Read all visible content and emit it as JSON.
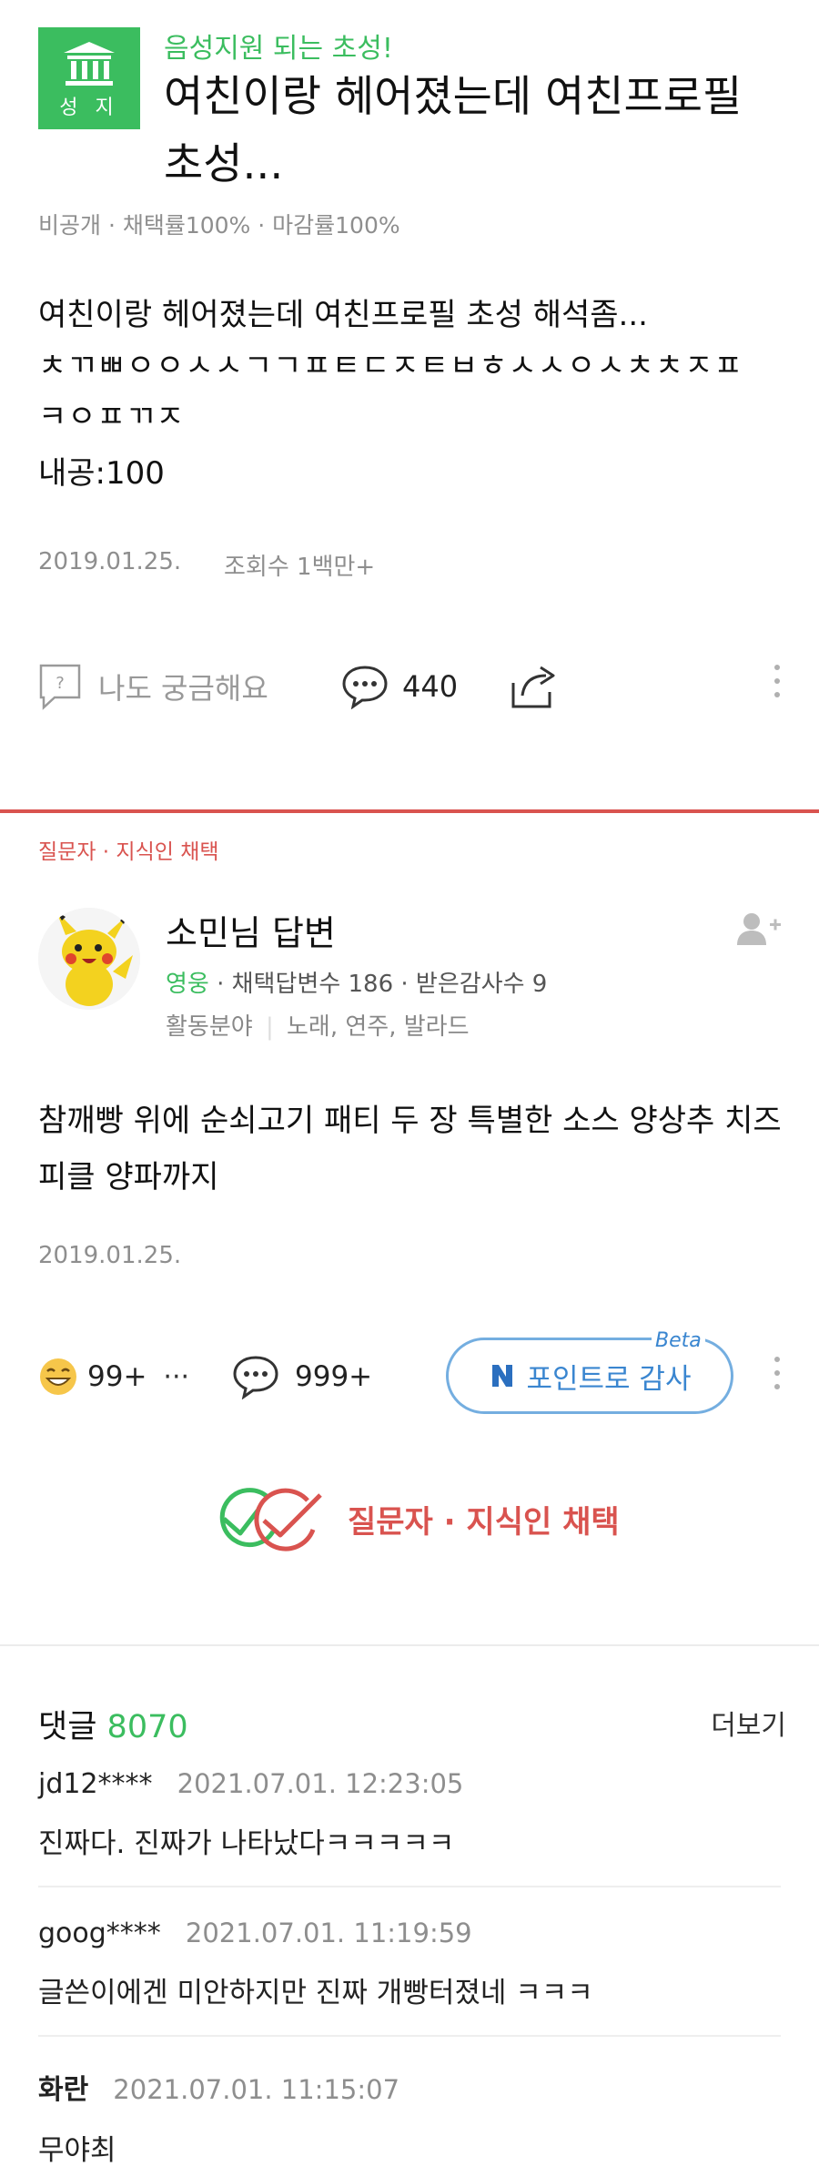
{
  "question": {
    "badge_label": "성 지",
    "tag": "음성지원 되는 초성!",
    "title": "여친이랑 헤어졌는데 여친프로필 초성...",
    "meta": "비공개 · 채택률100% · 마감률100%",
    "body_lines": [
      "여친이랑 헤어졌는데 여친프로필 초성 해석좀...",
      "ㅊㄲㅃㅇㅇㅅㅅㄱㄱㅍㅌㄷㅈㅌㅂㅎㅅㅅㅇㅅㅊㅊㅈㅍ",
      "ㅋㅇㅍㄲㅈ",
      "내공:100"
    ],
    "date": "2019.01.25.",
    "views": "조회수 1백만+",
    "curious_label": "나도 궁금해요",
    "comment_count": "440"
  },
  "answer": {
    "selected_label": "질문자 · 지식인 채택",
    "name": "소민님 답변",
    "grade": "영웅",
    "stats": "· 채택답변수 186 · 받은감사수 9",
    "activity_label": "활동분야",
    "activity_value": "노래, 연주, 발라드",
    "body": "참깨빵 위에 순쇠고기 패티 두 장 특별한 소스 양상추 치즈 피클 양파까지",
    "date": "2019.01.25.",
    "emoji_count": "99+",
    "more_dots": "···",
    "comment_count": "999+",
    "thanks_button": "포인트로 감사",
    "beta": "Beta",
    "select_stamp": "질문자 · 지식인 채택"
  },
  "comments": {
    "label": "댓글",
    "count": "8070",
    "more": "더보기",
    "items": [
      {
        "author": "jd12****",
        "time": "2021.07.01. 12:23:05",
        "text": "진짜다. 진짜가 나타났다ㅋㅋㅋㅋㅋ"
      },
      {
        "author": "goog****",
        "time": "2021.07.01. 11:19:59",
        "text": "글쓴이에겐 미안하지만 진짜 개빵터졌네 ㅋㅋㅋ"
      },
      {
        "author": "화란",
        "time": "2021.07.01. 11:15:07",
        "text": "무야최"
      }
    ]
  },
  "colors": {
    "accent_green": "#3bbd5f",
    "accent_red": "#d9534f",
    "accent_blue": "#3a86d0"
  }
}
